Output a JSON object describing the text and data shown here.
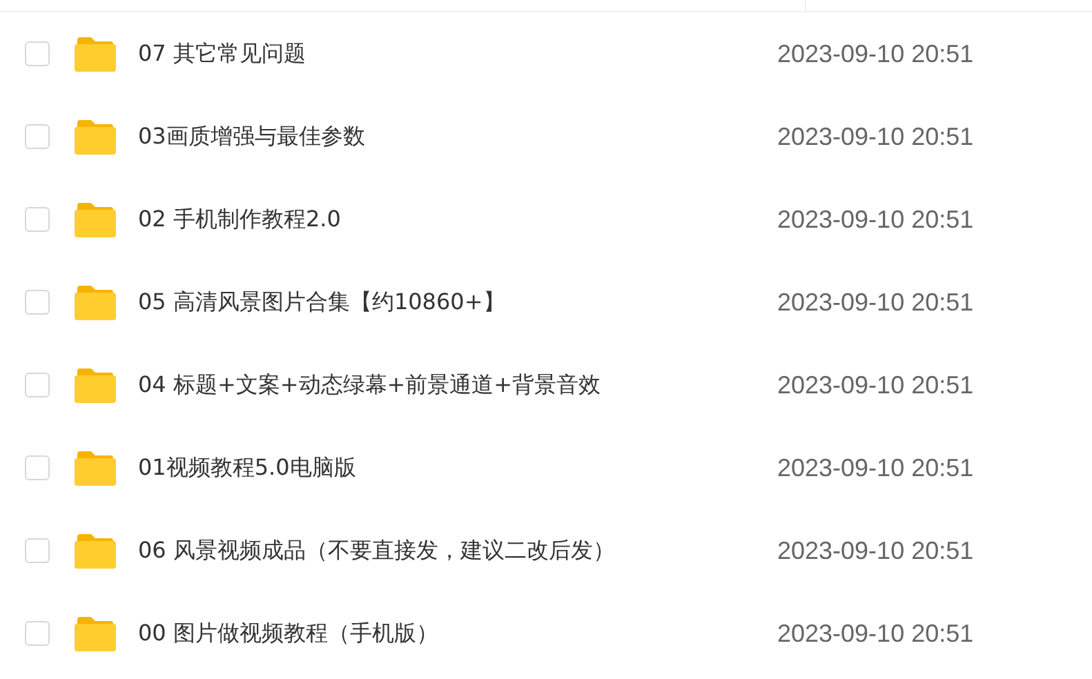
{
  "files": [
    {
      "name": "07 其它常见问题",
      "date": "2023-09-10 20:51",
      "checked": false
    },
    {
      "name": "03画质增强与最佳参数",
      "date": "2023-09-10 20:51",
      "checked": false
    },
    {
      "name": "02 手机制作教程2.0",
      "date": "2023-09-10 20:51",
      "checked": false
    },
    {
      "name": "05 高清风景图片合集【约10860+】",
      "date": "2023-09-10 20:51",
      "checked": false
    },
    {
      "name": "04 标题+文案+动态绿幕+前景通道+背景音效",
      "date": "2023-09-10 20:51",
      "checked": false
    },
    {
      "name": "01视频教程5.0电脑版",
      "date": "2023-09-10 20:51",
      "checked": false
    },
    {
      "name": "06 风景视频成品（不要直接发，建议二改后发）",
      "date": "2023-09-10 20:51",
      "checked": false
    },
    {
      "name": "00 图片做视频教程（手机版）",
      "date": "2023-09-10 20:51",
      "checked": false
    }
  ]
}
